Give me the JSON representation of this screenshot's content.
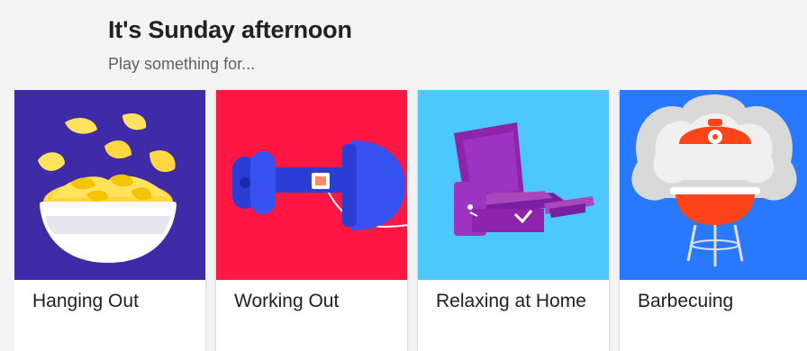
{
  "header": {
    "title": "It's Sunday afternoon",
    "subtitle": "Play something for..."
  },
  "cards": [
    {
      "label": "Hanging Out",
      "icon": "chips-bowl-icon",
      "color": "#3f2aa8"
    },
    {
      "label": "Working Out",
      "icon": "dumbbell-icon",
      "color": "#ff1744"
    },
    {
      "label": "Relaxing at Home",
      "icon": "recliner-icon",
      "color": "#4dc8ff"
    },
    {
      "label": "Barbecuing",
      "icon": "grill-icon",
      "color": "#2979ff"
    }
  ]
}
